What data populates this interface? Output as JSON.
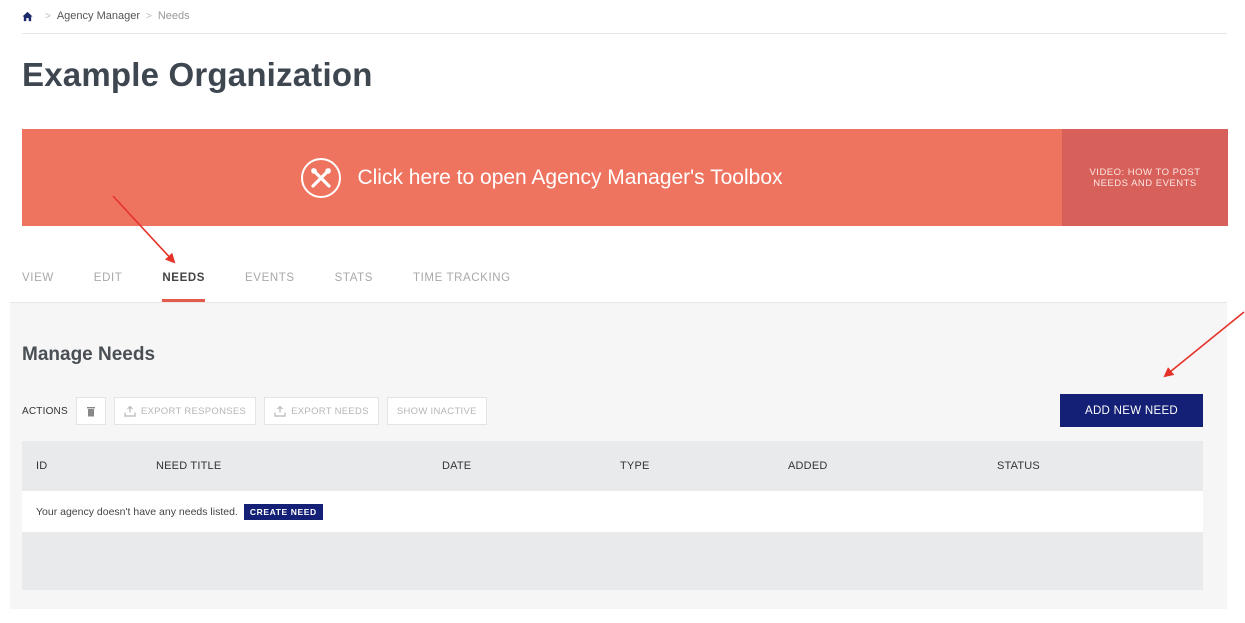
{
  "breadcrumb": {
    "home_icon": "home-icon",
    "items": [
      "Agency Manager",
      "Needs"
    ]
  },
  "page": {
    "title": "Example Organization"
  },
  "banner": {
    "icon": "tools-icon",
    "text": "Click here to open Agency Manager's Toolbox",
    "video_label": "VIDEO: HOW TO POST NEEDS AND EVENTS",
    "color": "#ef7460",
    "video_color": "#d7605a"
  },
  "tabs": [
    {
      "label": "VIEW",
      "active": false
    },
    {
      "label": "EDIT",
      "active": false
    },
    {
      "label": "NEEDS",
      "active": true
    },
    {
      "label": "EVENTS",
      "active": false
    },
    {
      "label": "STATS",
      "active": false
    },
    {
      "label": "TIME TRACKING",
      "active": false
    }
  ],
  "manage": {
    "title": "Manage Needs",
    "actions_label": "ACTIONS",
    "trash_icon": "trash-icon",
    "export_responses": "EXPORT RESPONSES",
    "export_needs": "EXPORT NEEDS",
    "show_inactive": "SHOW INACTIVE",
    "add_new_need": "ADD NEW NEED",
    "accent": "#132075"
  },
  "table": {
    "columns": [
      "ID",
      "NEED TITLE",
      "DATE",
      "TYPE",
      "ADDED",
      "STATUS"
    ],
    "empty_message": "Your agency doesn't have any needs listed.",
    "create_need": "CREATE NEED"
  },
  "annotations": {
    "arrow_color": "#e5332a"
  }
}
